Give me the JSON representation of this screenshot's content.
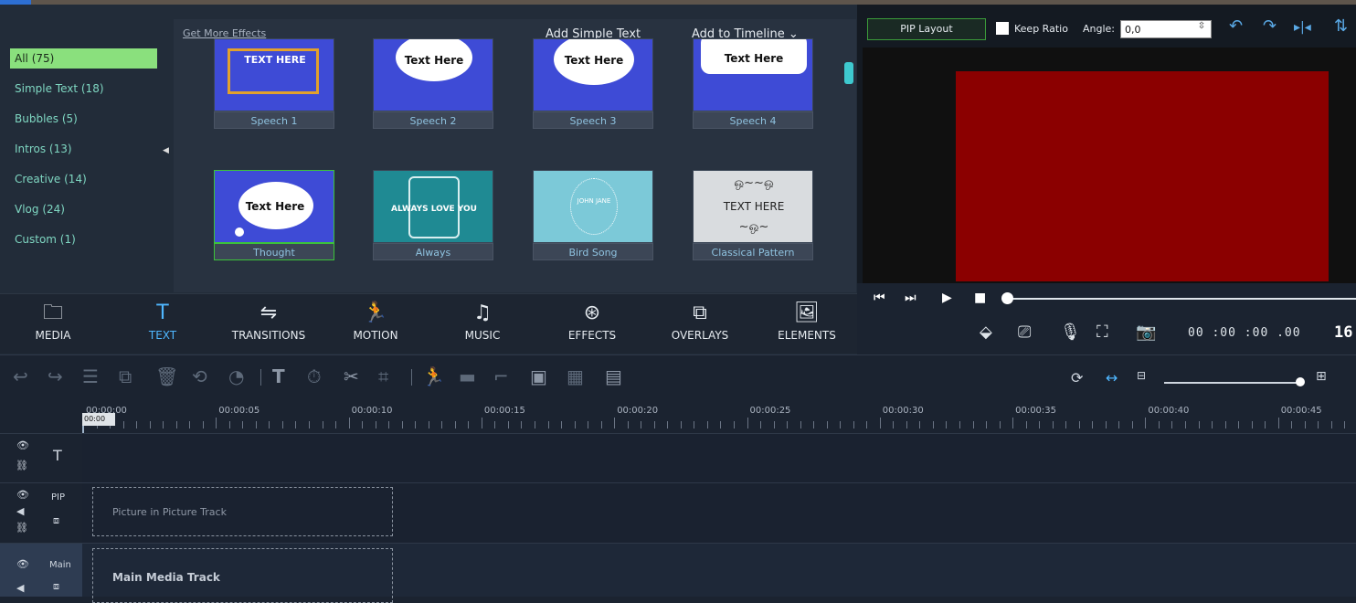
{
  "categories": [
    {
      "label": "All (75)",
      "active": true
    },
    {
      "label": "Simple Text (18)"
    },
    {
      "label": "Bubbles (5)"
    },
    {
      "label": "Intros (13)"
    },
    {
      "label": "Creative (14)"
    },
    {
      "label": "Vlog (24)"
    },
    {
      "label": "Custom (1)"
    }
  ],
  "effects_header": {
    "more": "Get More Effects",
    "add_simple": "Add Simple Text",
    "add_timeline": "Add to Timeline"
  },
  "tiles": [
    {
      "caption": "Speech 1",
      "text": "TEXT HERE"
    },
    {
      "caption": "Speech 2",
      "text": "Text Here"
    },
    {
      "caption": "Speech 3",
      "text": "Text Here"
    },
    {
      "caption": "Speech 4",
      "text": "Text Here"
    },
    {
      "caption": "Thought",
      "text": "Text Here"
    },
    {
      "caption": "Always",
      "text": "ALWAYS LOVE YOU"
    },
    {
      "caption": "Bird Song",
      "text": "JOHN JANE"
    },
    {
      "caption": "Classical Pattern",
      "text": "TEXT HERE"
    }
  ],
  "nav": [
    "MEDIA",
    "TEXT",
    "TRANSITIONS",
    "MOTION",
    "MUSIC",
    "EFFECTS",
    "OVERLAYS",
    "ELEMENTS"
  ],
  "preview": {
    "pip_layout": "PIP Layout",
    "keep_ratio": "Keep Ratio",
    "angle_label": "Angle:",
    "angle_value": "0,0",
    "timecode": "00 :00 :00 .00",
    "counter": "16"
  },
  "ruler": [
    "00:00:00",
    "00:00:05",
    "00:00:10",
    "00:00:15",
    "00:00:20",
    "00:00:25",
    "00:00:30",
    "00:00:35",
    "00:00:40",
    "00:00:45"
  ],
  "playhead_label": "00:00",
  "tracks": {
    "pip_head": "PIP",
    "main_head": "Main",
    "pip_label": "Picture in Picture Track",
    "main_label": "Main Media Track"
  },
  "colors": {
    "accent": "#4fb7ff",
    "active_cat": "#8ae07d",
    "preview_red": "#8b0000"
  }
}
